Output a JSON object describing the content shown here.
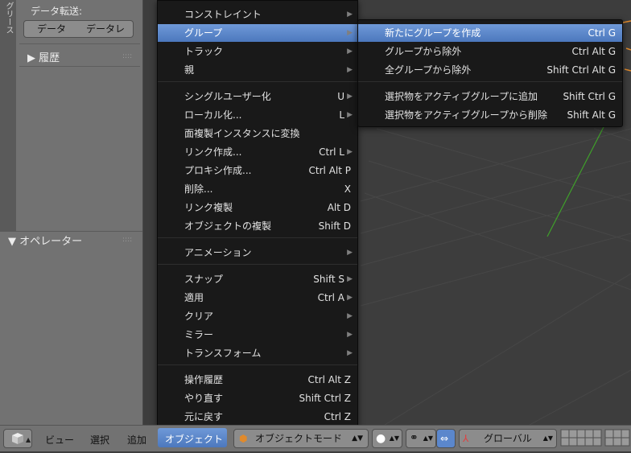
{
  "shelf": {
    "tab_text": "グリース",
    "data_transfer_label": "データ転送:",
    "btn_data": "データ",
    "btn_data_link": "データレ",
    "history_panel": "▶ 履歴",
    "operator_panel": "▼ オペレーター",
    "grip": "::::"
  },
  "main_menu": {
    "items": [
      {
        "label": "コンストレイント",
        "shortcut": "",
        "submenu": true
      },
      {
        "label": "グループ",
        "shortcut": "",
        "submenu": true,
        "highlighted": true
      },
      {
        "label": "トラック",
        "shortcut": "",
        "submenu": true
      },
      {
        "label": "親",
        "shortcut": "",
        "submenu": true
      },
      {
        "label": "シングルユーザー化",
        "shortcut": "U",
        "submenu": true
      },
      {
        "label": "ローカル化...",
        "shortcut": "L",
        "submenu": true
      },
      {
        "label": "面複製インスタンスに変換",
        "shortcut": "",
        "submenu": false
      },
      {
        "label": "リンク作成...",
        "shortcut": "Ctrl L",
        "submenu": true
      },
      {
        "label": "プロキシ作成...",
        "shortcut": "Ctrl Alt P",
        "submenu": false
      },
      {
        "label": "削除...",
        "shortcut": "X",
        "submenu": false
      },
      {
        "label": "リンク複製",
        "shortcut": "Alt D",
        "submenu": false
      },
      {
        "label": "オブジェクトの複製",
        "shortcut": "Shift D",
        "submenu": false
      },
      {
        "label": "アニメーション",
        "shortcut": "",
        "submenu": true
      },
      {
        "label": "スナップ",
        "shortcut": "Shift S",
        "submenu": true
      },
      {
        "label": "適用",
        "shortcut": "Ctrl A",
        "submenu": true
      },
      {
        "label": "クリア",
        "shortcut": "",
        "submenu": true
      },
      {
        "label": "ミラー",
        "shortcut": "",
        "submenu": true
      },
      {
        "label": "トランスフォーム",
        "shortcut": "",
        "submenu": true
      },
      {
        "label": "操作履歴",
        "shortcut": "Ctrl Alt Z",
        "submenu": false
      },
      {
        "label": "やり直す",
        "shortcut": "Shift Ctrl Z",
        "submenu": false
      },
      {
        "label": "元に戻す",
        "shortcut": "Ctrl Z",
        "submenu": false
      }
    ]
  },
  "sub_menu": {
    "items": [
      {
        "label": "新たにグループを作成",
        "shortcut": "Ctrl G",
        "highlighted": true
      },
      {
        "label": "グループから除外",
        "shortcut": "Ctrl Alt G"
      },
      {
        "label": "全グループから除外",
        "shortcut": "Shift Ctrl Alt G"
      },
      {
        "label": "選択物をアクティブグループに追加",
        "shortcut": "Shift Ctrl G"
      },
      {
        "label": "選択物をアクティブグループから削除",
        "shortcut": "Shift Alt G"
      }
    ]
  },
  "header": {
    "menu_view": "ビュー",
    "menu_select": "選択",
    "menu_add": "追加",
    "menu_object": "オブジェクト",
    "mode": "オブジェクトモード",
    "orientation": "グローバル"
  },
  "colors": {
    "highlight": "#5b87cc",
    "menu_bg": "#191919",
    "panel_bg": "#727272",
    "viewport_bg": "#3d3d3d",
    "axis_green": "#3fa02a",
    "object_orange": "#e08a2c"
  }
}
